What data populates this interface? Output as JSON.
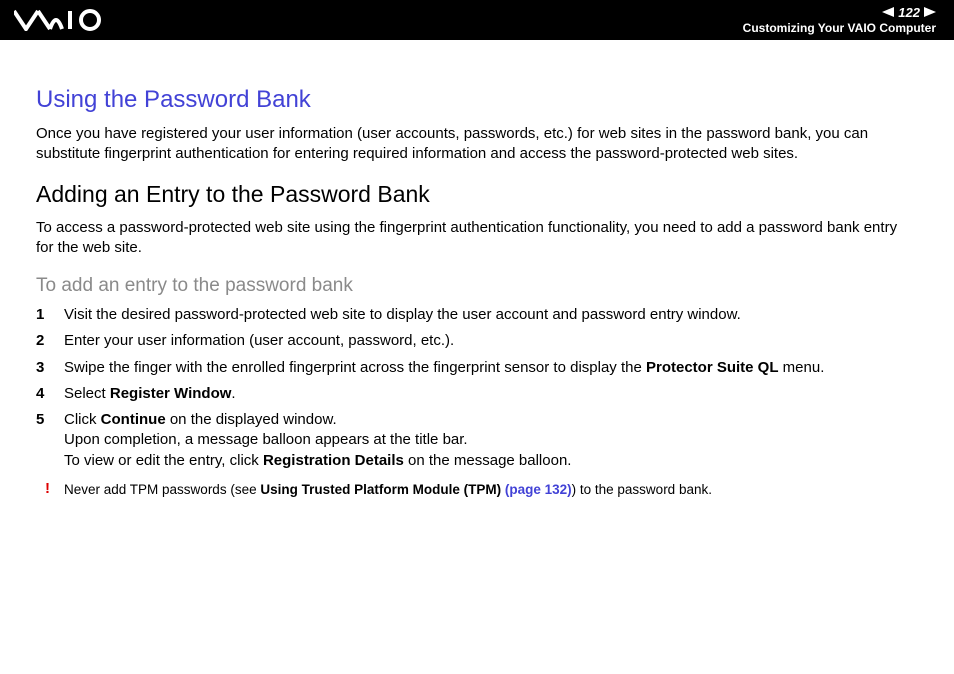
{
  "header": {
    "page_number": "122",
    "breadcrumb": "Customizing Your VAIO Computer"
  },
  "section": {
    "title": "Using the Password Bank",
    "intro": "Once you have registered your user information (user accounts, passwords, etc.) for web sites in the password bank, you can substitute fingerprint authentication for entering required information and access the password-protected web sites."
  },
  "subsection": {
    "title": "Adding an Entry to the Password Bank",
    "intro": "To access a password-protected web site using the fingerprint authentication functionality, you need to add a password bank entry for the web site.",
    "task_title": "To add an entry to the password bank",
    "steps": [
      {
        "text": "Visit the desired password-protected web site to display the user account and password entry window."
      },
      {
        "text": "Enter your user information (user account, password, etc.)."
      },
      {
        "pre": "Swipe the finger with the enrolled fingerprint across the fingerprint sensor to display the ",
        "bold": "Protector Suite QL",
        "post": " menu."
      },
      {
        "pre": "Select ",
        "bold": "Register Window",
        "post": "."
      },
      {
        "line1_pre": "Click ",
        "line1_bold": "Continue",
        "line1_post": " on the displayed window.",
        "line2": "Upon completion, a message balloon appears at the title bar.",
        "line3_pre": "To view or edit the entry, click ",
        "line3_bold": "Registration Details",
        "line3_post": " on the message balloon."
      }
    ],
    "note": {
      "pre": "Never add TPM passwords (see ",
      "bold": "Using Trusted Platform Module (TPM) ",
      "link": "(page 132)",
      "post": ") to the password bank."
    }
  }
}
